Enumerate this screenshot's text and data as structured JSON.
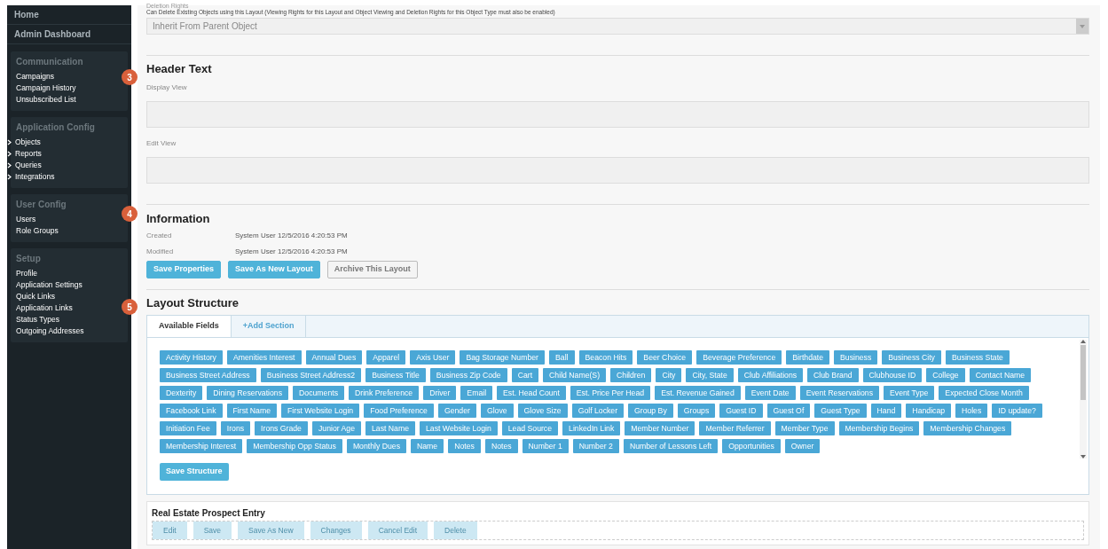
{
  "sidebar": {
    "top_links": [
      {
        "label": "Home"
      },
      {
        "label": "Admin Dashboard"
      }
    ],
    "groups": [
      {
        "title": "Communication",
        "items": [
          {
            "label": "Campaigns",
            "expandable": false
          },
          {
            "label": "Campaign History",
            "expandable": false
          },
          {
            "label": "Unsubscribed List",
            "expandable": false
          }
        ]
      },
      {
        "title": "Application Config",
        "items": [
          {
            "label": "Objects",
            "expandable": true
          },
          {
            "label": "Reports",
            "expandable": true
          },
          {
            "label": "Queries",
            "expandable": true
          },
          {
            "label": "Integrations",
            "expandable": true
          }
        ]
      },
      {
        "title": "User Config",
        "items": [
          {
            "label": "Users",
            "expandable": false
          },
          {
            "label": "Role Groups",
            "expandable": false
          }
        ]
      },
      {
        "title": "Setup",
        "items": [
          {
            "label": "Profile",
            "expandable": false
          },
          {
            "label": "Application Settings",
            "expandable": false
          },
          {
            "label": "Quick Links",
            "expandable": false
          },
          {
            "label": "Application Links",
            "expandable": false
          },
          {
            "label": "Status Types",
            "expandable": false
          },
          {
            "label": "Outgoing Addresses",
            "expandable": false
          }
        ]
      }
    ]
  },
  "deletion_rights": {
    "label": "Deletion Rights",
    "description": "Can Delete Existing Objects using this Layout (Viewing Rights for this Layout and Object Viewing and Deletion Rights for this Object Type must also be enabled)",
    "select": {
      "value": "Inherit From Parent Object"
    }
  },
  "header_text": {
    "step": "3",
    "title": "Header Text",
    "fields": [
      {
        "label": "Display View"
      },
      {
        "label": "Edit View"
      }
    ]
  },
  "information": {
    "step": "4",
    "title": "Information",
    "rows": [
      {
        "label": "Created",
        "value": "System User 12/5/2016 4:20:53 PM"
      },
      {
        "label": "Modified",
        "value": "System User 12/5/2016 4:20:53 PM"
      }
    ],
    "buttons": [
      {
        "label": "Save Properties",
        "kind": "primary"
      },
      {
        "label": "Save As New Layout",
        "kind": "primary"
      },
      {
        "label": "Archive This Layout",
        "kind": "default"
      }
    ]
  },
  "layout_structure": {
    "step": "5",
    "title": "Layout Structure",
    "tabs": [
      {
        "label": "Available Fields",
        "selected": true
      },
      {
        "label": "+Add Section",
        "selected": false
      }
    ],
    "fields": [
      "Activity History",
      "Amenities Interest",
      "Annual Dues",
      "Apparel",
      "Axis User",
      "Bag Storage Number",
      "Ball",
      "Beacon Hits",
      "Beer Choice",
      "Beverage Preference",
      "Birthdate",
      "Business",
      "Business City",
      "Business State",
      "Business Street Address",
      "Business Street Address2",
      "Business Title",
      "Business Zip Code",
      "Cart",
      "Child Name(S)",
      "Children",
      "City",
      "City, State",
      "Club Affiliations",
      "Club Brand",
      "Clubhouse ID",
      "College",
      "Contact Name",
      "Dexterity",
      "Dining Reservations",
      "Documents",
      "Drink Preference",
      "Driver",
      "Email",
      "Est. Head Count",
      "Est. Price Per Head",
      "Est. Revenue Gained",
      "Event Date",
      "Event Reservations",
      "Event Type",
      "Expected Close Month",
      "Facebook Link",
      "First Name",
      "First Website Login",
      "Food Preference",
      "Gender",
      "Glove",
      "Glove Size",
      "Golf Locker",
      "Group By",
      "Groups",
      "Guest ID",
      "Guest Of",
      "Guest Type",
      "Hand",
      "Handicap",
      "Holes",
      "ID update?",
      "Initiation Fee",
      "Irons",
      "Irons Grade",
      "Junior Age",
      "Last Name",
      "Last Website Login",
      "Lead Source",
      "LinkedIn Link",
      "Member Number",
      "Member Referrer",
      "Member Type",
      "Membership Begins",
      "Membership Changes",
      "Membership Interest",
      "Membership Opp Status",
      "Monthly Dues",
      "Name",
      "Notes",
      "Notes",
      "Number 1",
      "Number 2",
      "Number of Lessons Left",
      "Opportunities",
      "Owner"
    ],
    "save_button": "Save Structure"
  },
  "form_preview": {
    "title": "Real Estate Prospect Entry",
    "buttons": [
      {
        "label": "Edit",
        "disabled": true
      },
      {
        "label": "Save",
        "disabled": true
      },
      {
        "label": "Save As New",
        "disabled": true
      },
      {
        "label": "Changes",
        "disabled": true
      },
      {
        "label": "Cancel Edit",
        "disabled": true
      },
      {
        "label": "Delete",
        "disabled": true
      }
    ]
  }
}
